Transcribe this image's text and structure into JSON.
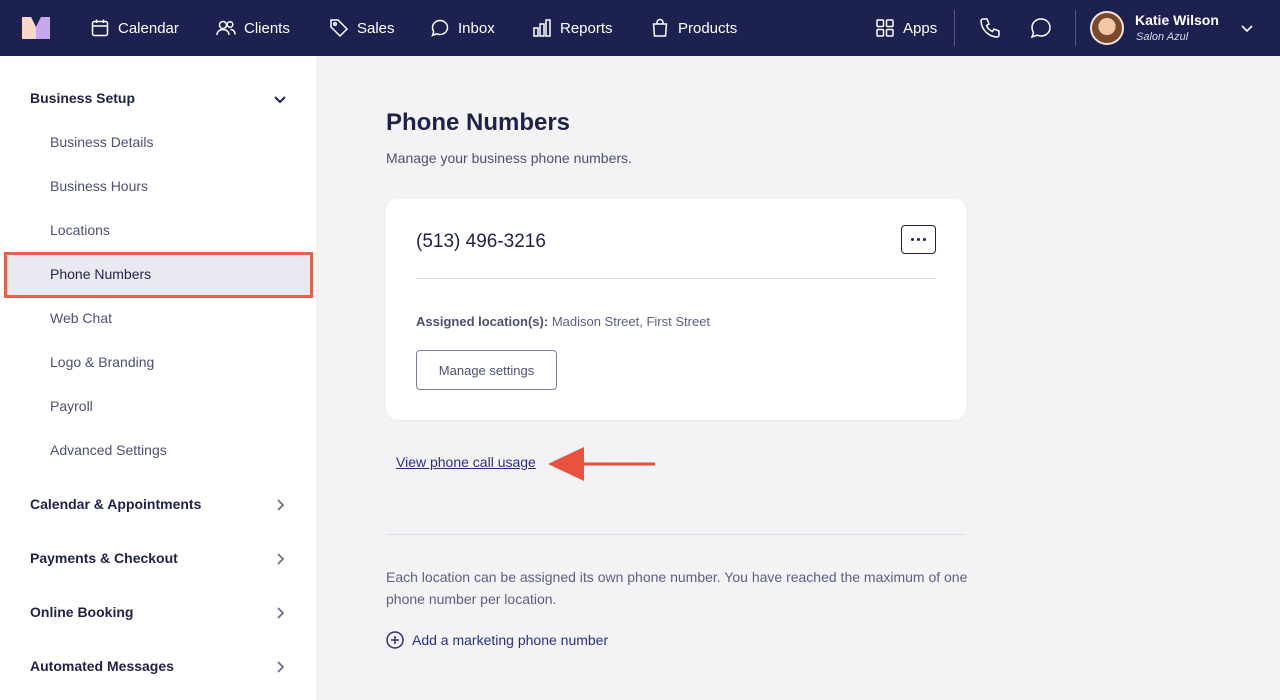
{
  "topbar": {
    "nav": [
      {
        "label": "Calendar",
        "icon": "calendar-icon"
      },
      {
        "label": "Clients",
        "icon": "users-icon"
      },
      {
        "label": "Sales",
        "icon": "tag-icon"
      },
      {
        "label": "Inbox",
        "icon": "inbox-icon"
      },
      {
        "label": "Reports",
        "icon": "bar-chart-icon"
      },
      {
        "label": "Products",
        "icon": "shopping-bag-icon"
      }
    ],
    "apps_label": "Apps",
    "user": {
      "name": "Katie Wilson",
      "salon": "Salon Azul"
    }
  },
  "sidebar": {
    "business_setup": {
      "label": "Business Setup",
      "items": [
        "Business Details",
        "Business Hours",
        "Locations",
        "Phone Numbers",
        "Web Chat",
        "Logo & Branding",
        "Payroll",
        "Advanced Settings"
      ],
      "active": "Phone Numbers"
    },
    "sections": [
      "Calendar & Appointments",
      "Payments & Checkout",
      "Online Booking",
      "Automated Messages"
    ]
  },
  "main": {
    "title": "Phone Numbers",
    "subtitle": "Manage your business phone numbers.",
    "card": {
      "phone": "(513) 496-3216",
      "assigned_label": "Assigned location(s):",
      "assigned_value": "Madison Street, First Street",
      "manage_button": "Manage settings"
    },
    "usage_link": "View phone call usage",
    "info_text": "Each location can be assigned its own phone number. You have reached the maximum of one phone number per location.",
    "add_link": "Add a marketing phone number"
  },
  "colors": {
    "topbar": "#1c2150",
    "highlight": "#e8604c",
    "text_primary": "#1d2248",
    "link": "#2a3080"
  }
}
